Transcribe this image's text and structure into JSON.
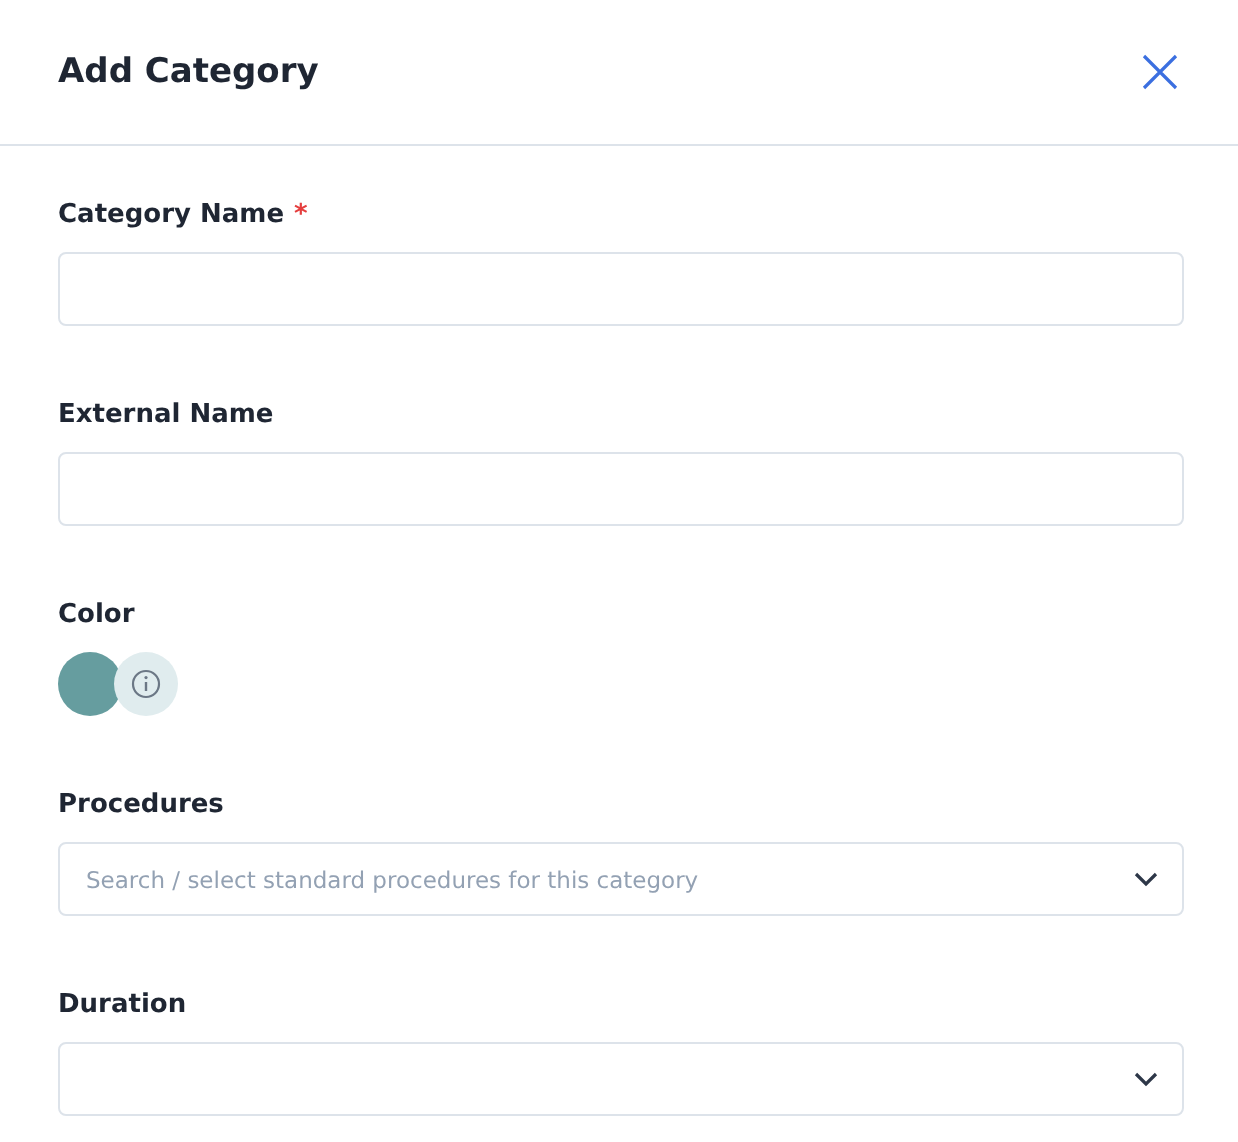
{
  "dialog": {
    "title": "Add Category"
  },
  "fields": [
    {
      "kind": "text",
      "label": "Category Name",
      "required_mark": "*"
    },
    {
      "kind": "text",
      "label": "External Name"
    },
    {
      "kind": "color",
      "label": "Color",
      "color": "#669d9f"
    },
    {
      "kind": "select",
      "label": "Procedures",
      "placeholder": "Search / select standard procedures for this category"
    },
    {
      "kind": "select",
      "label": "Duration"
    }
  ]
}
